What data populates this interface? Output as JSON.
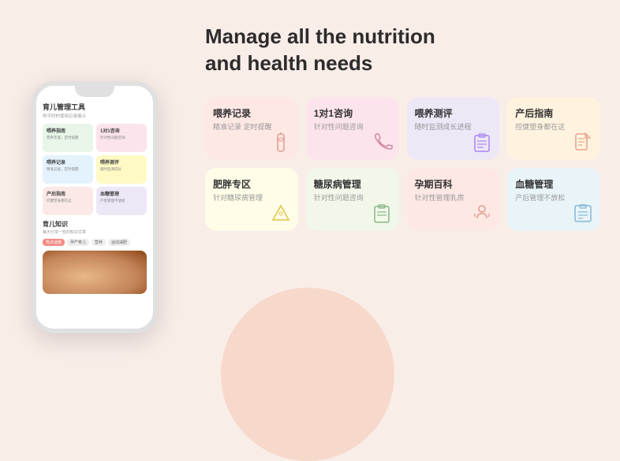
{
  "background": {
    "color": "#f9ede8"
  },
  "headline": {
    "line1": "Manage all the nutrition",
    "line2": "and health needs"
  },
  "phone": {
    "section1_title": "育儿管理工具",
    "section1_subtitle": "你平时的使用记录展示",
    "cards": [
      {
        "title": "喂养指南",
        "sub": "营养丰富，定时提醒",
        "color": "pc-green",
        "icon": "🍼"
      },
      {
        "title": "1对1咨询",
        "sub": "针对性问题咨询",
        "color": "pc-pink",
        "icon": "📞"
      },
      {
        "title": "喂养记录",
        "sub": "精准记录，定时提醒",
        "color": "pc-blue",
        "icon": "📋"
      },
      {
        "title": "喂养测评",
        "sub": "随时监测成长进程",
        "color": "pc-yellow",
        "icon": "📊"
      },
      {
        "title": "产后指南",
        "sub": "控健塑身都在这",
        "color": "pc-orange",
        "icon": "📄"
      },
      {
        "title": "血糖管理",
        "sub": "产后管理不放松",
        "color": "pc-lavender",
        "icon": "📊"
      }
    ],
    "section2_title": "育儿知识",
    "section2_subtitle": "每天分享一些的知识文章",
    "tags": [
      "热点话题",
      "孕产育儿",
      "营养",
      "運动减肥"
    ],
    "active_tag": 0
  },
  "feature_cards": [
    {
      "id": "feeding-record",
      "title": "喂养记录",
      "subtitle": "精准记录 定时提醒",
      "color": "card-salmon",
      "icon": "baby-bottle"
    },
    {
      "id": "one-on-one",
      "title": "1对1咨询",
      "subtitle": "针对性问题咨询",
      "color": "card-pink-light",
      "icon": "phone"
    },
    {
      "id": "feeding-eval",
      "title": "喂养测评",
      "subtitle": "随时监测成长进程",
      "color": "card-lavender",
      "icon": "clipboard"
    },
    {
      "id": "postpartum",
      "title": "产后指南",
      "subtitle": "控健塑身都在这",
      "color": "card-peach",
      "icon": "document"
    },
    {
      "id": "obesity",
      "title": "肥胖专区",
      "subtitle": "针对糖尿病管理",
      "color": "card-yellow",
      "icon": "pizza"
    },
    {
      "id": "diabetes",
      "title": "糖尿病管理",
      "subtitle": "针对性问题咨询",
      "color": "card-green",
      "icon": "clipboard2"
    },
    {
      "id": "pregnancy",
      "title": "孕期百科",
      "subtitle": "针对性管理乳房",
      "color": "card-salmon",
      "icon": "baby"
    },
    {
      "id": "blood-sugar",
      "title": "血糖管理",
      "subtitle": "产后管理不放松",
      "color": "card-blue",
      "icon": "chart"
    }
  ]
}
